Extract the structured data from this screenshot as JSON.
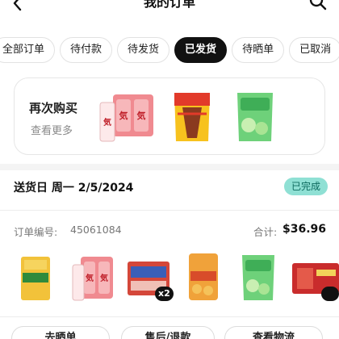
{
  "header": {
    "title": "我的订单",
    "back_icon": "chevron-left-icon",
    "search_icon": "search-icon"
  },
  "tabs": [
    {
      "label": "全部订单",
      "active": false
    },
    {
      "label": "待付款",
      "active": false
    },
    {
      "label": "待发货",
      "active": false
    },
    {
      "label": "已发货",
      "active": true
    },
    {
      "label": "待晒单",
      "active": false
    },
    {
      "label": "已取消",
      "active": false
    }
  ],
  "buy_again": {
    "title": "再次购买",
    "subtitle": "查看更多",
    "products": [
      {
        "name": "气 drink cans pack",
        "color": "#f08a90"
      },
      {
        "name": "鬼脸嗦 snack bag",
        "color": "#e23a2a"
      },
      {
        "name": "溜溜梅 plum bag",
        "color": "#6ed17a"
      }
    ]
  },
  "order": {
    "delivery_text": "送货日 周一 2/5/2024",
    "status": "已完成",
    "order_number_label": "订单编号:",
    "order_number": "45061084",
    "total_label": "合计:",
    "total": "$36.96",
    "item_quantity_badge": "x2",
    "items": [
      {
        "name": "yellow rice pack",
        "color": "#f2c23a"
      },
      {
        "name": "气 drink cans pack",
        "color": "#f08a90"
      },
      {
        "name": "sausage pack",
        "color": "#b7392e"
      },
      {
        "name": "九制梅 jar",
        "color": "#f0a23a"
      },
      {
        "name": "溜溜梅 plum bag",
        "color": "#6ed17a"
      },
      {
        "name": "red tea box",
        "color": "#c92c2c"
      }
    ]
  },
  "actions": [
    {
      "label": "去晒单"
    },
    {
      "label": "售后/退款"
    },
    {
      "label": "查看物流"
    }
  ],
  "colors": {
    "accent": "#111111",
    "status_bg": "#8fe0d4",
    "status_text": "#0c6a5e"
  }
}
